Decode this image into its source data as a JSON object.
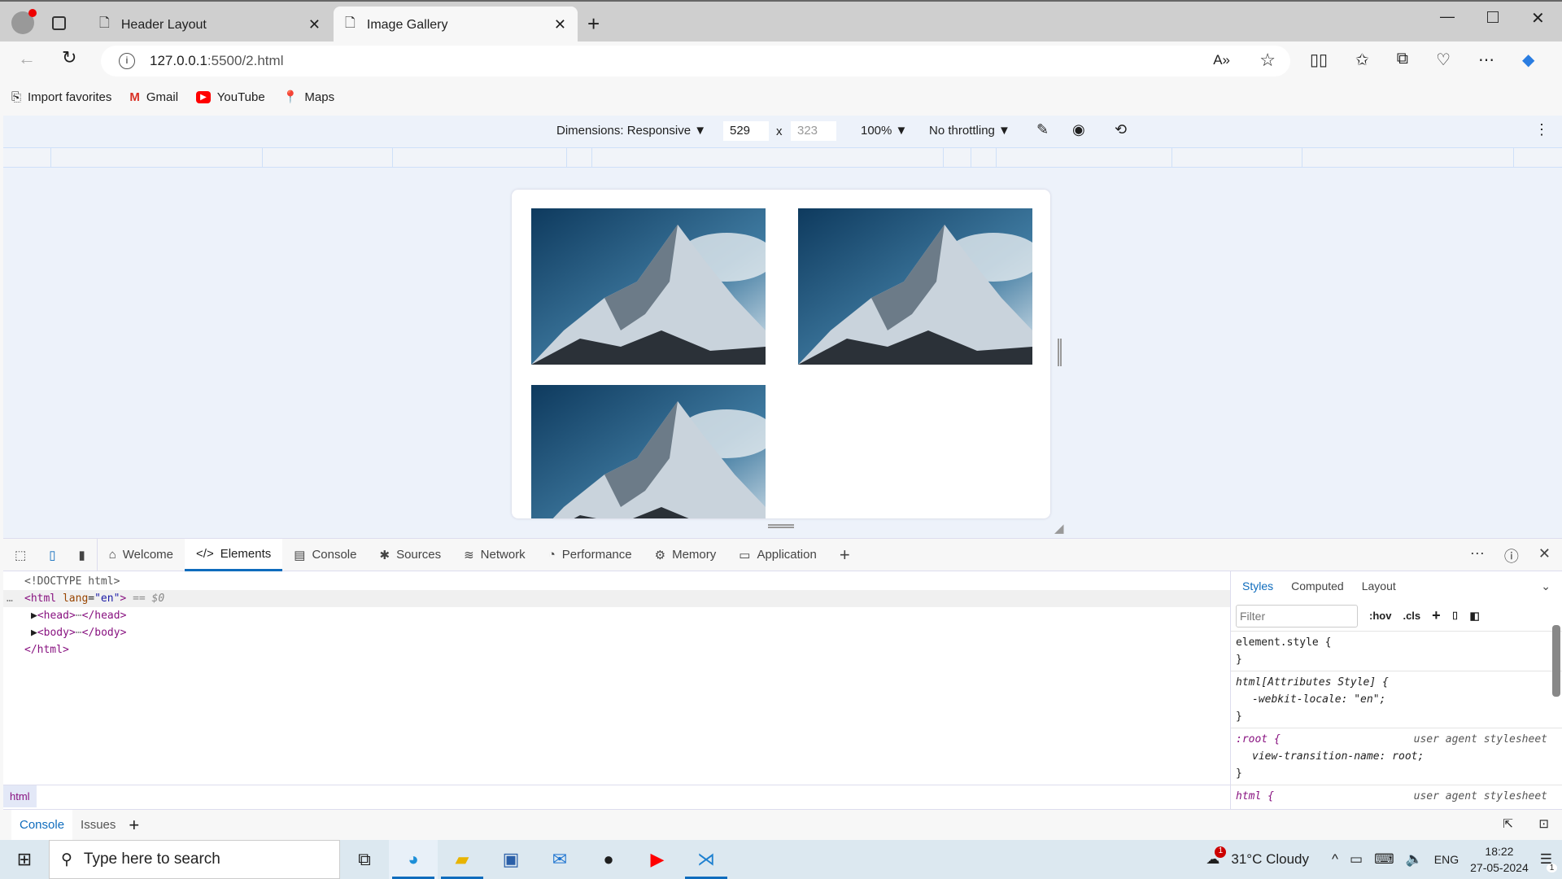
{
  "browser": {
    "tabs": [
      {
        "title": "Header Layout",
        "active": false
      },
      {
        "title": "Image Gallery",
        "active": true
      }
    ],
    "url_host": "127.0.0.1",
    "url_path": ":5500/2.html",
    "bookmarks": [
      {
        "label": "Import favorites",
        "icon": "import-icon"
      },
      {
        "label": "Gmail",
        "icon": "gmail-icon"
      },
      {
        "label": "YouTube",
        "icon": "youtube-icon"
      },
      {
        "label": "Maps",
        "icon": "maps-icon"
      }
    ]
  },
  "device_toolbar": {
    "dimensions": "Dimensions: Responsive",
    "width": "529",
    "x": "x",
    "height": "323",
    "zoom": "100%",
    "throttling": "No throttling"
  },
  "page": {
    "images": [
      {
        "alt": "mountain"
      },
      {
        "alt": "mountain"
      },
      {
        "alt": "mountain"
      }
    ],
    "colors": {
      "sky": "#1d4f78",
      "snow": "#e8eef3"
    }
  },
  "devtools": {
    "tabs": [
      {
        "label": "Welcome"
      },
      {
        "label": "Elements",
        "active": true
      },
      {
        "label": "Console"
      },
      {
        "label": "Sources"
      },
      {
        "label": "Network"
      },
      {
        "label": "Performance"
      },
      {
        "label": "Memory"
      },
      {
        "label": "Application"
      }
    ],
    "dom": {
      "doctype": "<!DOCTYPE html>",
      "html_open": "<html",
      "lang_attr": "lang",
      "lang_val": "\"en\"",
      "close_bracket": ">",
      "selected_marker": "== $0",
      "head": "<head>",
      "head_close": "</head>",
      "body": "<body>",
      "body_close": "</body>",
      "html_close": "</html>",
      "ellipsis": "⋯"
    },
    "breadcrumb": "html",
    "styles_tabs": [
      "Styles",
      "Computed",
      "Layout"
    ],
    "filter_placeholder": "Filter",
    "hov": ":hov",
    "cls": ".cls",
    "rules": [
      {
        "selector": "element.style {",
        "decls": [],
        "close": "}"
      },
      {
        "selector": "html[Attributes Style] {",
        "decls": [
          "-webkit-locale: \"en\";"
        ],
        "close": "}"
      },
      {
        "selector": ":root {",
        "source": "user agent stylesheet",
        "decls": [
          "view-transition-name: root;"
        ],
        "close": "}"
      },
      {
        "selector": "html {",
        "source": "user agent stylesheet",
        "decls": [],
        "close": ""
      }
    ],
    "drawer_tabs": [
      "Console",
      "Issues"
    ]
  },
  "taskbar": {
    "search_placeholder": "Type here to search",
    "weather": "31°C  Cloudy",
    "weather_badge": "1",
    "lang": "ENG",
    "time": "18:22",
    "date": "27-05-2024",
    "notif_count": "1"
  }
}
